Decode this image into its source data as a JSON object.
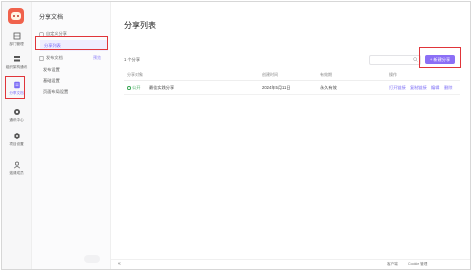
{
  "rail": {
    "items": [
      {
        "label": "部门管理",
        "icon": "building-icon"
      },
      {
        "label": "组织架构通讯",
        "icon": "org-icon"
      },
      {
        "label": "分享文档",
        "icon": "share-doc-icon"
      },
      {
        "label": "通讯中心",
        "icon": "cloud-icon"
      },
      {
        "label": "项目设置",
        "icon": "gear-icon"
      },
      {
        "label": "邀请成员",
        "icon": "user-icon"
      }
    ]
  },
  "sidebar": {
    "title": "分享文档",
    "group1": "自定义分享",
    "active_item": "分享列表",
    "group2": "发布文档",
    "group2_badge": "预览",
    "items": [
      "发布设置",
      "基础设置",
      "页面布局设置"
    ]
  },
  "main": {
    "title": "分享列表",
    "count": "1 个分享",
    "new_button": "+ 新建分享",
    "columns": [
      "分享对象",
      "",
      "创建时间",
      "有效期",
      "操作"
    ],
    "rows": [
      {
        "status": "公开",
        "name": "最佳实践分享",
        "created": "2024年5月11日",
        "expiry": "永久有效",
        "actions": [
          "打开链接",
          "复制链接",
          "编辑",
          "删除"
        ]
      }
    ]
  },
  "footer": {
    "collapse": "«",
    "items": [
      "客户端",
      "Cookie 管理"
    ],
    "accent": "#8b6ff6"
  }
}
